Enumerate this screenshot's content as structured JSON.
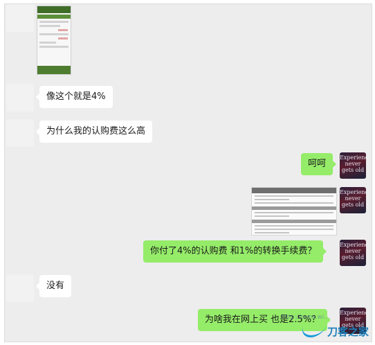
{
  "avatar_right": {
    "text": "Experience never gets old"
  },
  "messages": [
    {
      "side": "left",
      "type": "image",
      "name": "trade-screenshot"
    },
    {
      "side": "left",
      "type": "text",
      "text": "像这个就是4%"
    },
    {
      "side": "left",
      "type": "text",
      "text": "为什么我的认购费这么高"
    },
    {
      "side": "right",
      "type": "text",
      "text": "呵呵"
    },
    {
      "side": "right",
      "type": "image",
      "name": "order-screenshot"
    },
    {
      "side": "right",
      "type": "text",
      "text": "你付了4%的认购费 和1%的转换手续费？"
    },
    {
      "side": "left",
      "type": "text",
      "text": "没有"
    },
    {
      "side": "right",
      "type": "text",
      "text": "为啥我在网上买 也是2.5%？"
    }
  ],
  "watermark": {
    "site": "刀客之家",
    "url": "http://www.wi..."
  }
}
